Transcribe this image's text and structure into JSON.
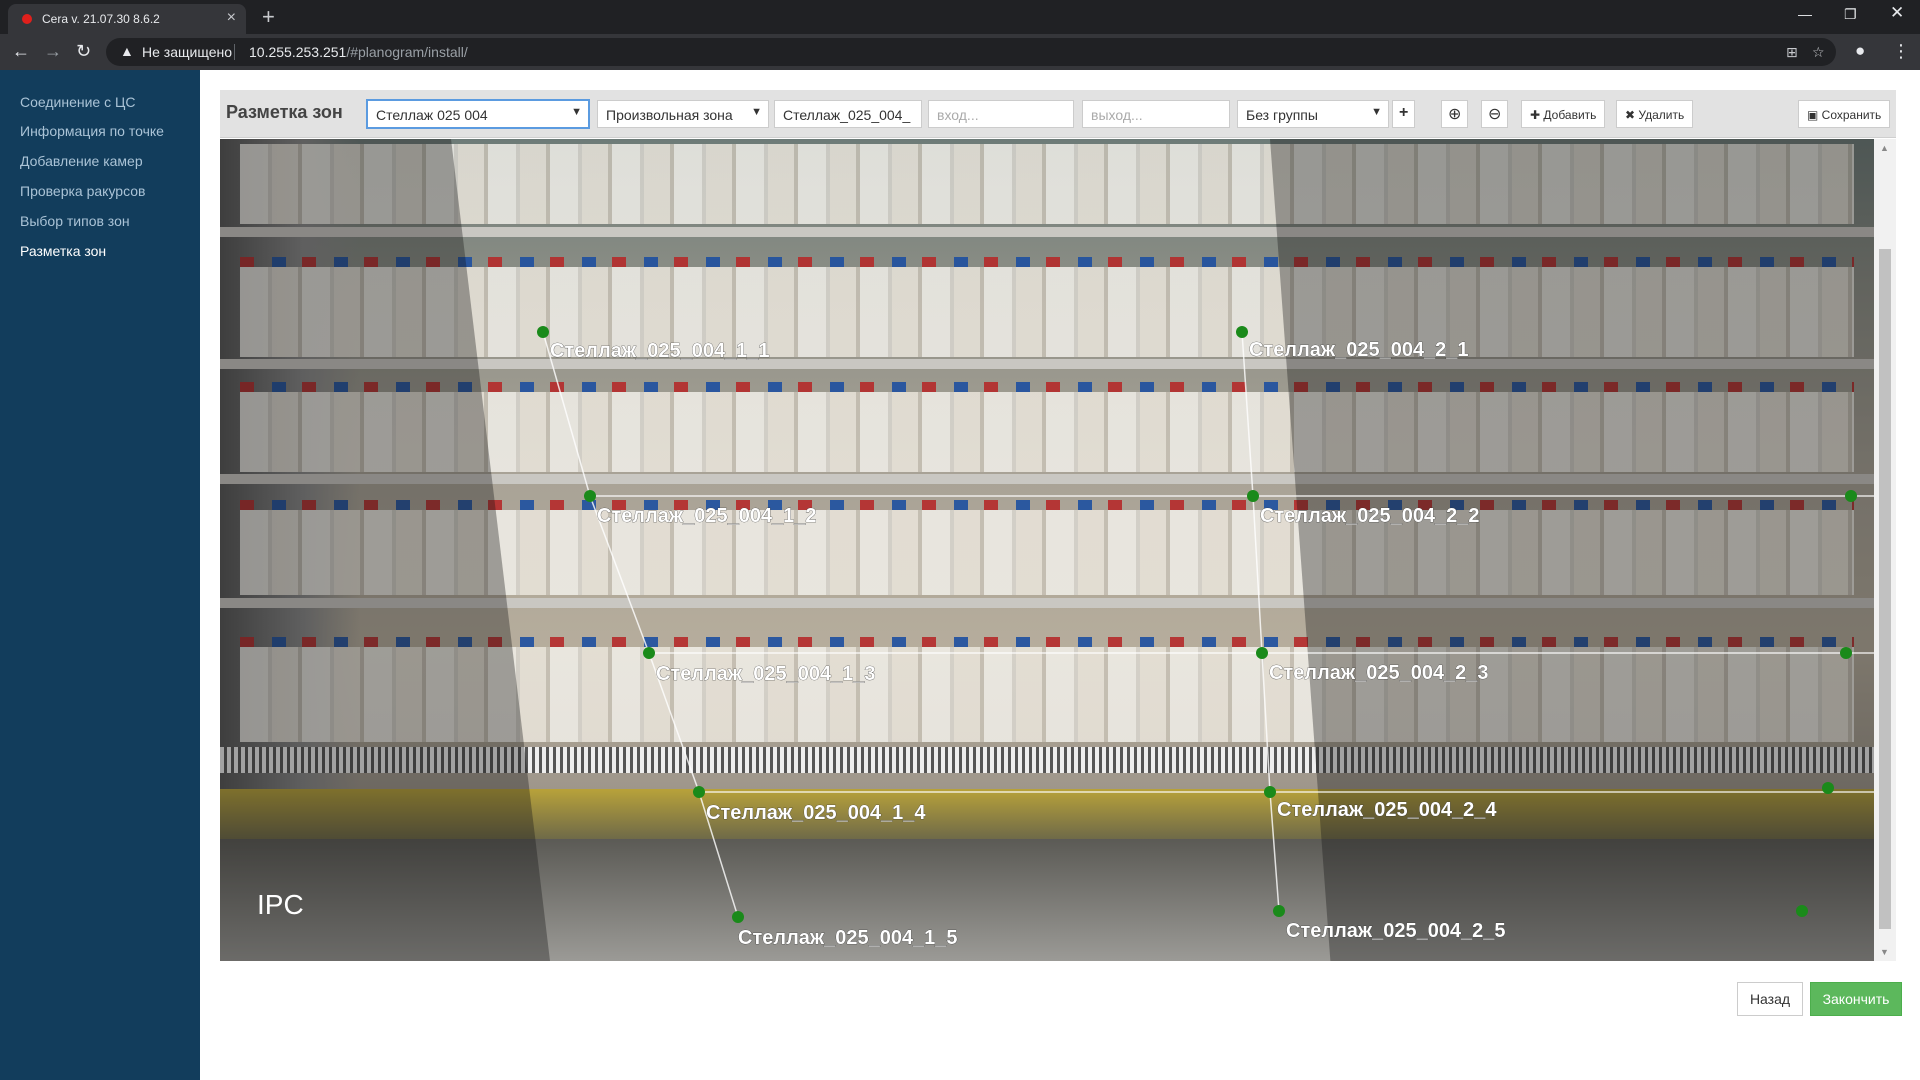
{
  "browser": {
    "tab_title": "Cera v. 21.07.30 8.6.2",
    "security_label": "Не защищено",
    "url_host": "10.255.253.251",
    "url_path": "/#planogram/install/"
  },
  "sidebar": {
    "items": [
      {
        "label": "Соединение с ЦС"
      },
      {
        "label": "Информация по точке"
      },
      {
        "label": "Добавление камер"
      },
      {
        "label": "Проверка ракурсов"
      },
      {
        "label": "Выбор типов зон"
      },
      {
        "label": "Разметка зон"
      }
    ]
  },
  "zone_toolbar": {
    "title": "Разметка зон",
    "rack_select": "Стеллаж  025  004",
    "zone_type_select": "Произвольная зона",
    "zone_name": "Стеллаж_025_004_",
    "entry_placeholder": "вход...",
    "exit_placeholder": "выход...",
    "group_select": "Без группы",
    "add_label": "Добавить",
    "delete_label": "Удалить",
    "save_label": "Сохранить"
  },
  "camera": {
    "watermark": "IPC",
    "zones": [
      "Стеллаж_025_004_1_1",
      "Стеллаж_025_004_1_2",
      "Стеллаж_025_004_1_3",
      "Стеллаж_025_004_1_4",
      "Стеллаж_025_004_1_5",
      "Стеллаж_025_004_2_1",
      "Стеллаж_025_004_2_2",
      "Стеллаж_025_004_2_3",
      "Стеллаж_025_004_2_4",
      "Стеллаж_025_004_2_5"
    ]
  },
  "footer": {
    "back_label": "Назад",
    "finish_label": "Закончить"
  },
  "colors": {
    "sidebar_bg": "#123d5c",
    "marker_green": "#1a8a1a",
    "finish_green": "#5cb85c"
  }
}
